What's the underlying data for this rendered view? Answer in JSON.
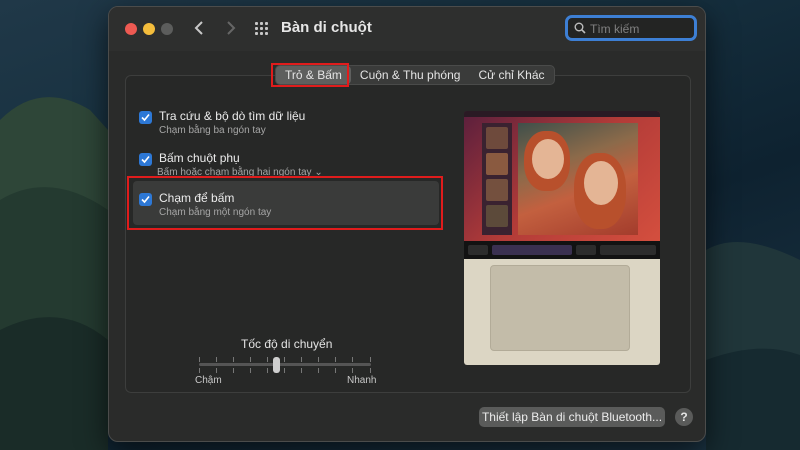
{
  "window": {
    "title": "Bàn di chuột"
  },
  "search": {
    "placeholder": "Tìm kiếm"
  },
  "tabs": [
    {
      "label": "Trỏ & Bấm",
      "active": true
    },
    {
      "label": "Cuộn & Thu phóng",
      "active": false
    },
    {
      "label": "Cử chỉ Khác",
      "active": false
    }
  ],
  "options": [
    {
      "title": "Tra cứu & bộ dò tìm dữ liệu",
      "subtitle": "Chạm bằng ba ngón tay",
      "checked": true
    },
    {
      "title": "Bấm chuột phụ",
      "subtitle": "Bấm hoặc chạm bằng hai ngón tay ⌄",
      "checked": true
    },
    {
      "title": "Chạm để bấm",
      "subtitle": "Chạm bằng một ngón tay",
      "checked": true
    }
  ],
  "tracking_speed": {
    "label": "Tốc độ di chuyển",
    "min_label": "Chậm",
    "max_label": "Nhanh",
    "level": 0.45
  },
  "buttons": {
    "bluetooth_setup": "Thiết lập Bàn di chuột Bluetooth...",
    "help": "?"
  },
  "colors": {
    "accent": "#2d78d6",
    "highlight": "#e01c1c",
    "close": "#ee5a52",
    "minimize": "#f4bd3c"
  }
}
